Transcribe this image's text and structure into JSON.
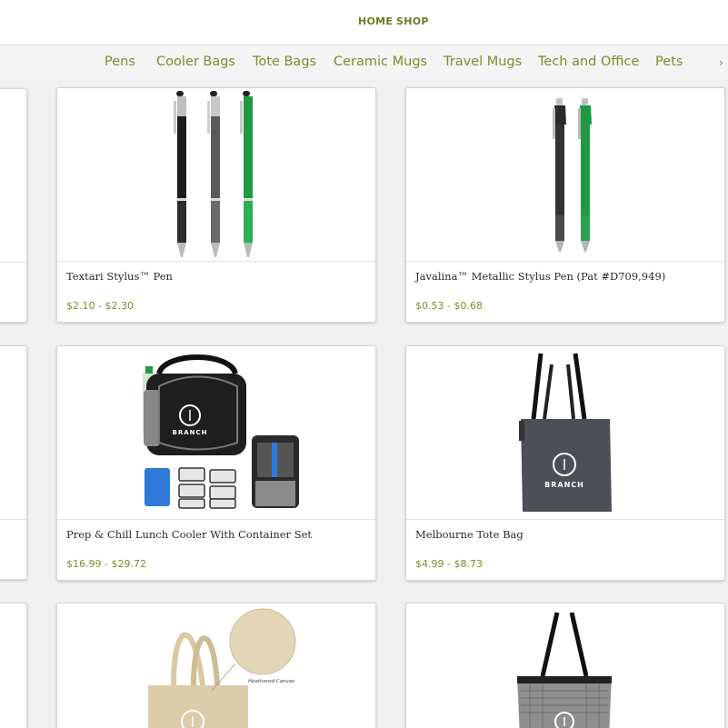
{
  "topnav": {
    "home": "HOME",
    "shop": "SHOP"
  },
  "categories": {
    "items": [
      "Pens",
      "Cooler Bags",
      "Tote Bags",
      "Ceramic Mugs",
      "Travel Mugs",
      "Tech and Office",
      "Pets"
    ],
    "next_icon": "chevron-right-icon"
  },
  "products": [
    {
      "title": "Textari Stylus™ Pen",
      "price": "$2.10 - $2.30"
    },
    {
      "title": "Javalina™ Metallic Stylus Pen (Pat #D709,949)",
      "price": "$0.53 - $0.68"
    },
    {
      "title": "Prep & Chill Lunch Cooler With Container Set",
      "price": "$16.99 - $29.72"
    },
    {
      "title": "Melbourne Tote Bag",
      "price": "$4.99 - $8.73"
    },
    {
      "title": "",
      "price": ""
    },
    {
      "title": "",
      "price": ""
    }
  ],
  "images": {
    "brand_label": "BRANCH",
    "canvas_note": "Heathered Canvas"
  },
  "colors": {
    "accent": "#7a8f2b",
    "nav": "#6b7a25",
    "pen_green": "#1f9a43"
  }
}
